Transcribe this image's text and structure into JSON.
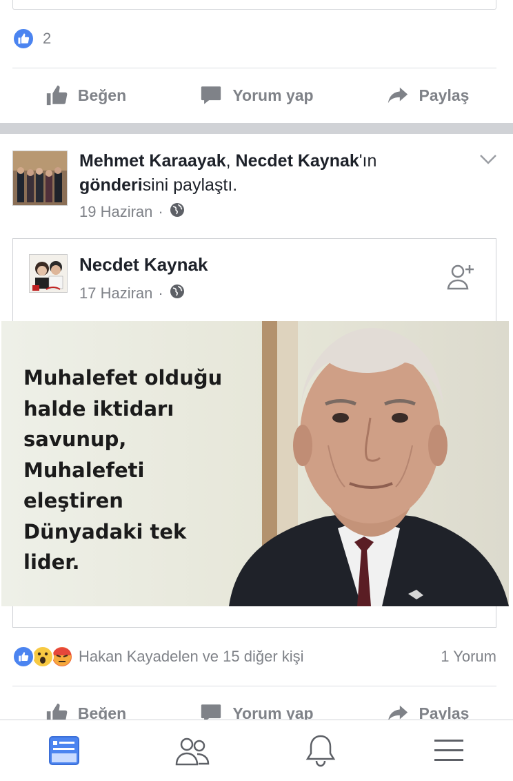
{
  "previous_post": {
    "like_count": "2",
    "actions": {
      "like": "Beğen",
      "comment": "Yorum yap",
      "share": "Paylaş"
    }
  },
  "shared_post": {
    "sharer": "Mehmet Karaayak",
    "separator": ", ",
    "original_author_possessive": "Necdet Kaynak",
    "possessive_suffix": "'ın",
    "post_word": "gönderi",
    "shared_suffix": "sini paylaştı.",
    "date": "19 Haziran",
    "dot": "·",
    "privacy_icon": "globe-icon",
    "menu_icon": "chevron-down-icon"
  },
  "inner_post": {
    "author": "Necdet Kaynak",
    "date": "17 Haziran",
    "dot": "·",
    "privacy_icon": "globe-icon",
    "add_friend_icon": "add-friend-icon",
    "image_text": "Muhalefet olduğu\nhalde iktidarı\nsavunup,\nMuhalefeti\neleştiren\nDünyadaki tek\nlider."
  },
  "reactions": {
    "icons": [
      "like-icon",
      "wow-icon",
      "angry-icon"
    ],
    "names": "Hakan Kayadelen ve 15 diğer kişi",
    "comments": "1 Yorum"
  },
  "actions": {
    "like": "Beğen",
    "comment": "Yorum yap",
    "share": "Paylaş"
  },
  "tabbar": {
    "items": [
      "news-feed-icon",
      "friends-icon",
      "notifications-icon",
      "menu-icon"
    ],
    "active": "news-feed-icon"
  },
  "colors": {
    "accent": "#4b84f0",
    "muted": "#7f8288",
    "separator": "#d0d2d6"
  }
}
